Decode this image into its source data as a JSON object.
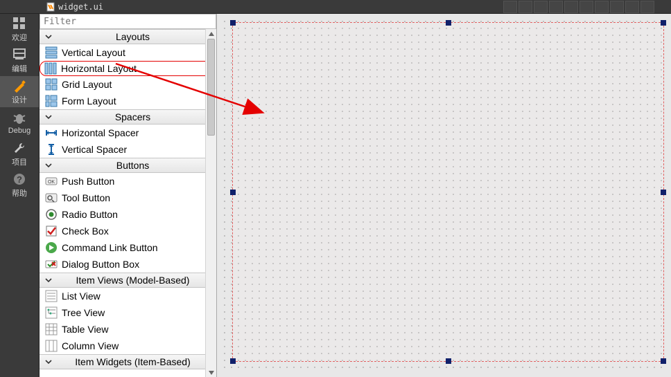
{
  "tab": {
    "filename": "widget.ui"
  },
  "sidebar": [
    {
      "key": "welcome",
      "label": "欢迎"
    },
    {
      "key": "edit",
      "label": "编辑"
    },
    {
      "key": "design",
      "label": "设计",
      "active": true
    },
    {
      "key": "debug",
      "label": "Debug"
    },
    {
      "key": "project",
      "label": "项目"
    },
    {
      "key": "help",
      "label": "帮助"
    }
  ],
  "filter_placeholder": "Filter",
  "widgetbox": [
    {
      "category": "Layouts",
      "items": [
        {
          "icon": "vlayout",
          "label": "Vertical Layout"
        },
        {
          "icon": "hlayout",
          "label": "Horizontal Layout",
          "highlighted": true
        },
        {
          "icon": "gridlayout",
          "label": "Grid Layout"
        },
        {
          "icon": "formlayout",
          "label": "Form Layout"
        }
      ]
    },
    {
      "category": "Spacers",
      "items": [
        {
          "icon": "hspacer",
          "label": "Horizontal Spacer"
        },
        {
          "icon": "vspacer",
          "label": "Vertical Spacer"
        }
      ]
    },
    {
      "category": "Buttons",
      "items": [
        {
          "icon": "pushbutton",
          "label": "Push Button"
        },
        {
          "icon": "toolbutton",
          "label": "Tool Button"
        },
        {
          "icon": "radiobutton",
          "label": "Radio Button"
        },
        {
          "icon": "checkbox",
          "label": "Check Box"
        },
        {
          "icon": "cmdlink",
          "label": "Command Link Button"
        },
        {
          "icon": "dlgbuttonbox",
          "label": "Dialog Button Box"
        }
      ]
    },
    {
      "category": "Item Views (Model-Based)",
      "items": [
        {
          "icon": "listview",
          "label": "List View"
        },
        {
          "icon": "treeview",
          "label": "Tree View"
        },
        {
          "icon": "tableview",
          "label": "Table View"
        },
        {
          "icon": "columnview",
          "label": "Column View"
        }
      ]
    },
    {
      "category": "Item Widgets (Item-Based)",
      "items": []
    }
  ]
}
